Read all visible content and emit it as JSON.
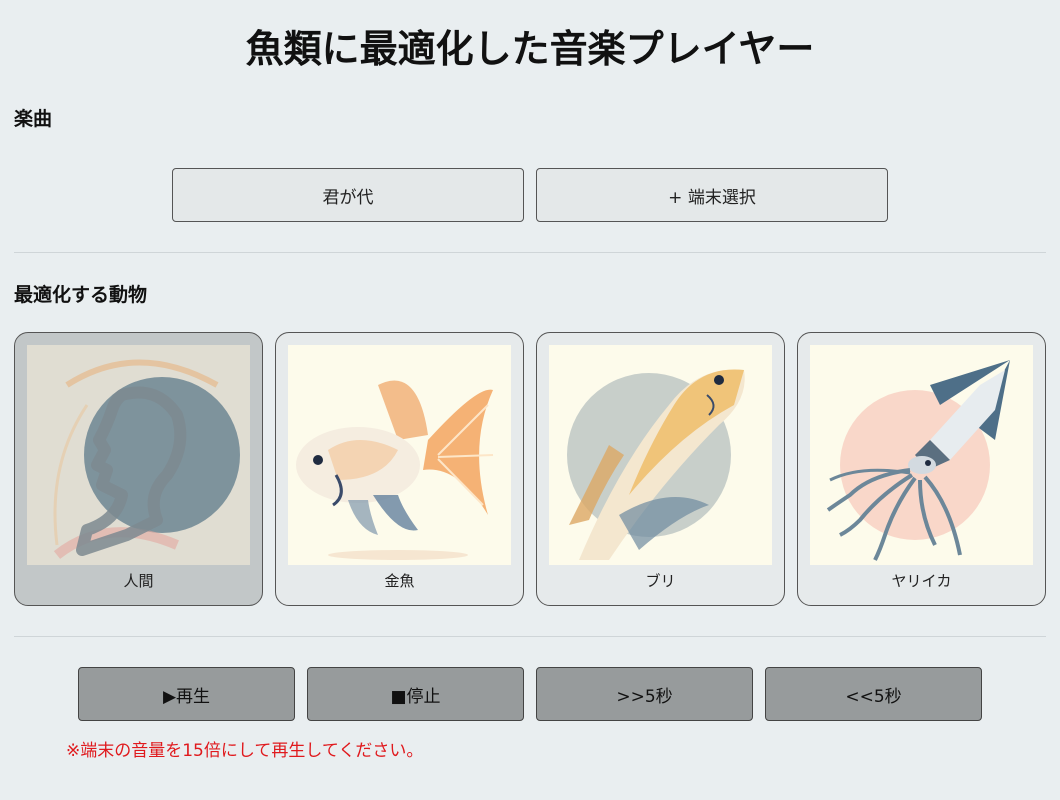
{
  "header": {
    "title": "魚類に最適化した音楽プレイヤー"
  },
  "songs": {
    "heading": "楽曲",
    "items": [
      {
        "label": "君が代"
      },
      {
        "label": "+ 端末選択"
      }
    ]
  },
  "animals": {
    "heading": "最適化する動物",
    "selected": "人間",
    "items": [
      {
        "label": "人間",
        "icon": "human-head-icon"
      },
      {
        "label": "金魚",
        "icon": "goldfish-icon"
      },
      {
        "label": "ブリ",
        "icon": "yellowtail-fish-icon"
      },
      {
        "label": "ヤリイカ",
        "icon": "squid-icon"
      }
    ]
  },
  "controls": {
    "play": "▶再生",
    "stop": "■停止",
    "forward": ">>5秒",
    "back": "<<5秒"
  },
  "note": "※端末の音量を15倍にして再生してください。",
  "colors": {
    "background": "#e9eef0",
    "selected_card": "#c2c7c8",
    "control_button": "#979b9c",
    "warning_text": "#e0191d"
  }
}
